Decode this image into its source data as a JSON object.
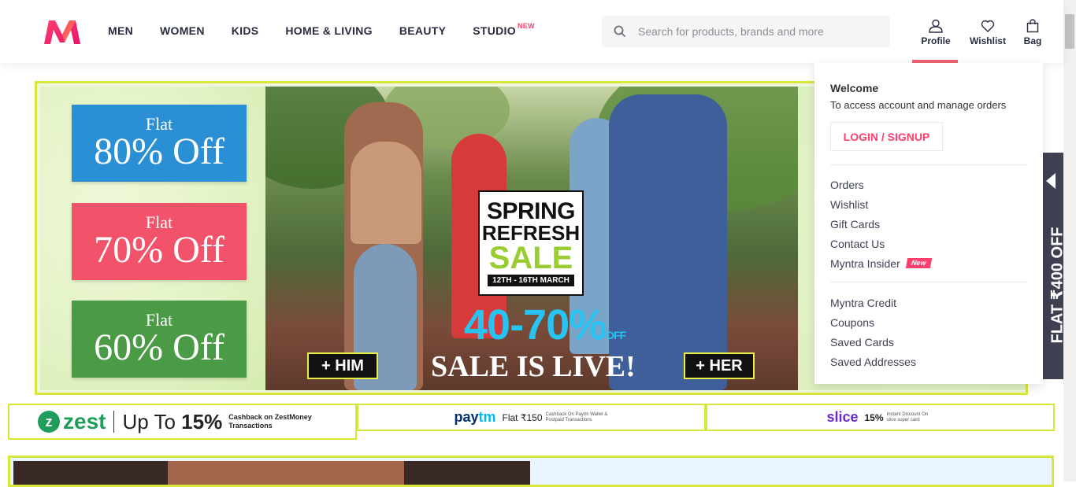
{
  "header": {
    "nav": [
      {
        "label": "MEN"
      },
      {
        "label": "WOMEN"
      },
      {
        "label": "KIDS"
      },
      {
        "label": "HOME & LIVING"
      },
      {
        "label": "BEAUTY"
      },
      {
        "label": "STUDIO",
        "badge": "NEW"
      }
    ],
    "search_placeholder": "Search for products, brands and more",
    "actions": {
      "profile": "Profile",
      "wishlist": "Wishlist",
      "bag": "Bag"
    },
    "accent_color": "#ff3f6c"
  },
  "banner": {
    "offers": [
      {
        "flat": "Flat",
        "pct": "80% Off",
        "color": "#2b8fd6"
      },
      {
        "flat": "Flat",
        "pct": "70% Off",
        "color": "#f2536a"
      },
      {
        "flat": "Flat",
        "pct": "60% Off",
        "color": "#4a9a46"
      }
    ],
    "sale_line1": "SPRING",
    "sale_line2": "REFRESH",
    "sale_line3": "SALE",
    "sale_dates": "12TH - 16TH MARCH",
    "discount_range": "40-70%",
    "discount_suffix": "OFF",
    "sale_live": "SALE IS LIVE!",
    "him_button": "+ HIM",
    "her_button": "+ HER",
    "side_tab_text": "FLAT ₹400 OFF"
  },
  "offer_strip": {
    "zest": {
      "brand": "zest",
      "text_up": "Up To",
      "text_pct": "15%",
      "text_small": "Cashback on ZestMoney Transactions"
    },
    "paytm": {
      "brand_a": "pay",
      "brand_b": "tm",
      "text": "Flat ₹150",
      "small": "Cashback On Paytm Wallet & Postpaid Transactions"
    },
    "slice": {
      "brand": "slice",
      "text": "15%",
      "small": "Instant Discount On slice super card"
    }
  },
  "dropdown": {
    "welcome": "Welcome",
    "subtitle": "To access account and manage orders",
    "login_button": "LOGIN / SIGNUP",
    "group1": [
      "Orders",
      "Wishlist",
      "Gift Cards",
      "Contact Us"
    ],
    "insider": "Myntra Insider",
    "insider_badge": "New",
    "group2": [
      "Myntra Credit",
      "Coupons",
      "Saved Cards",
      "Saved Addresses"
    ]
  }
}
